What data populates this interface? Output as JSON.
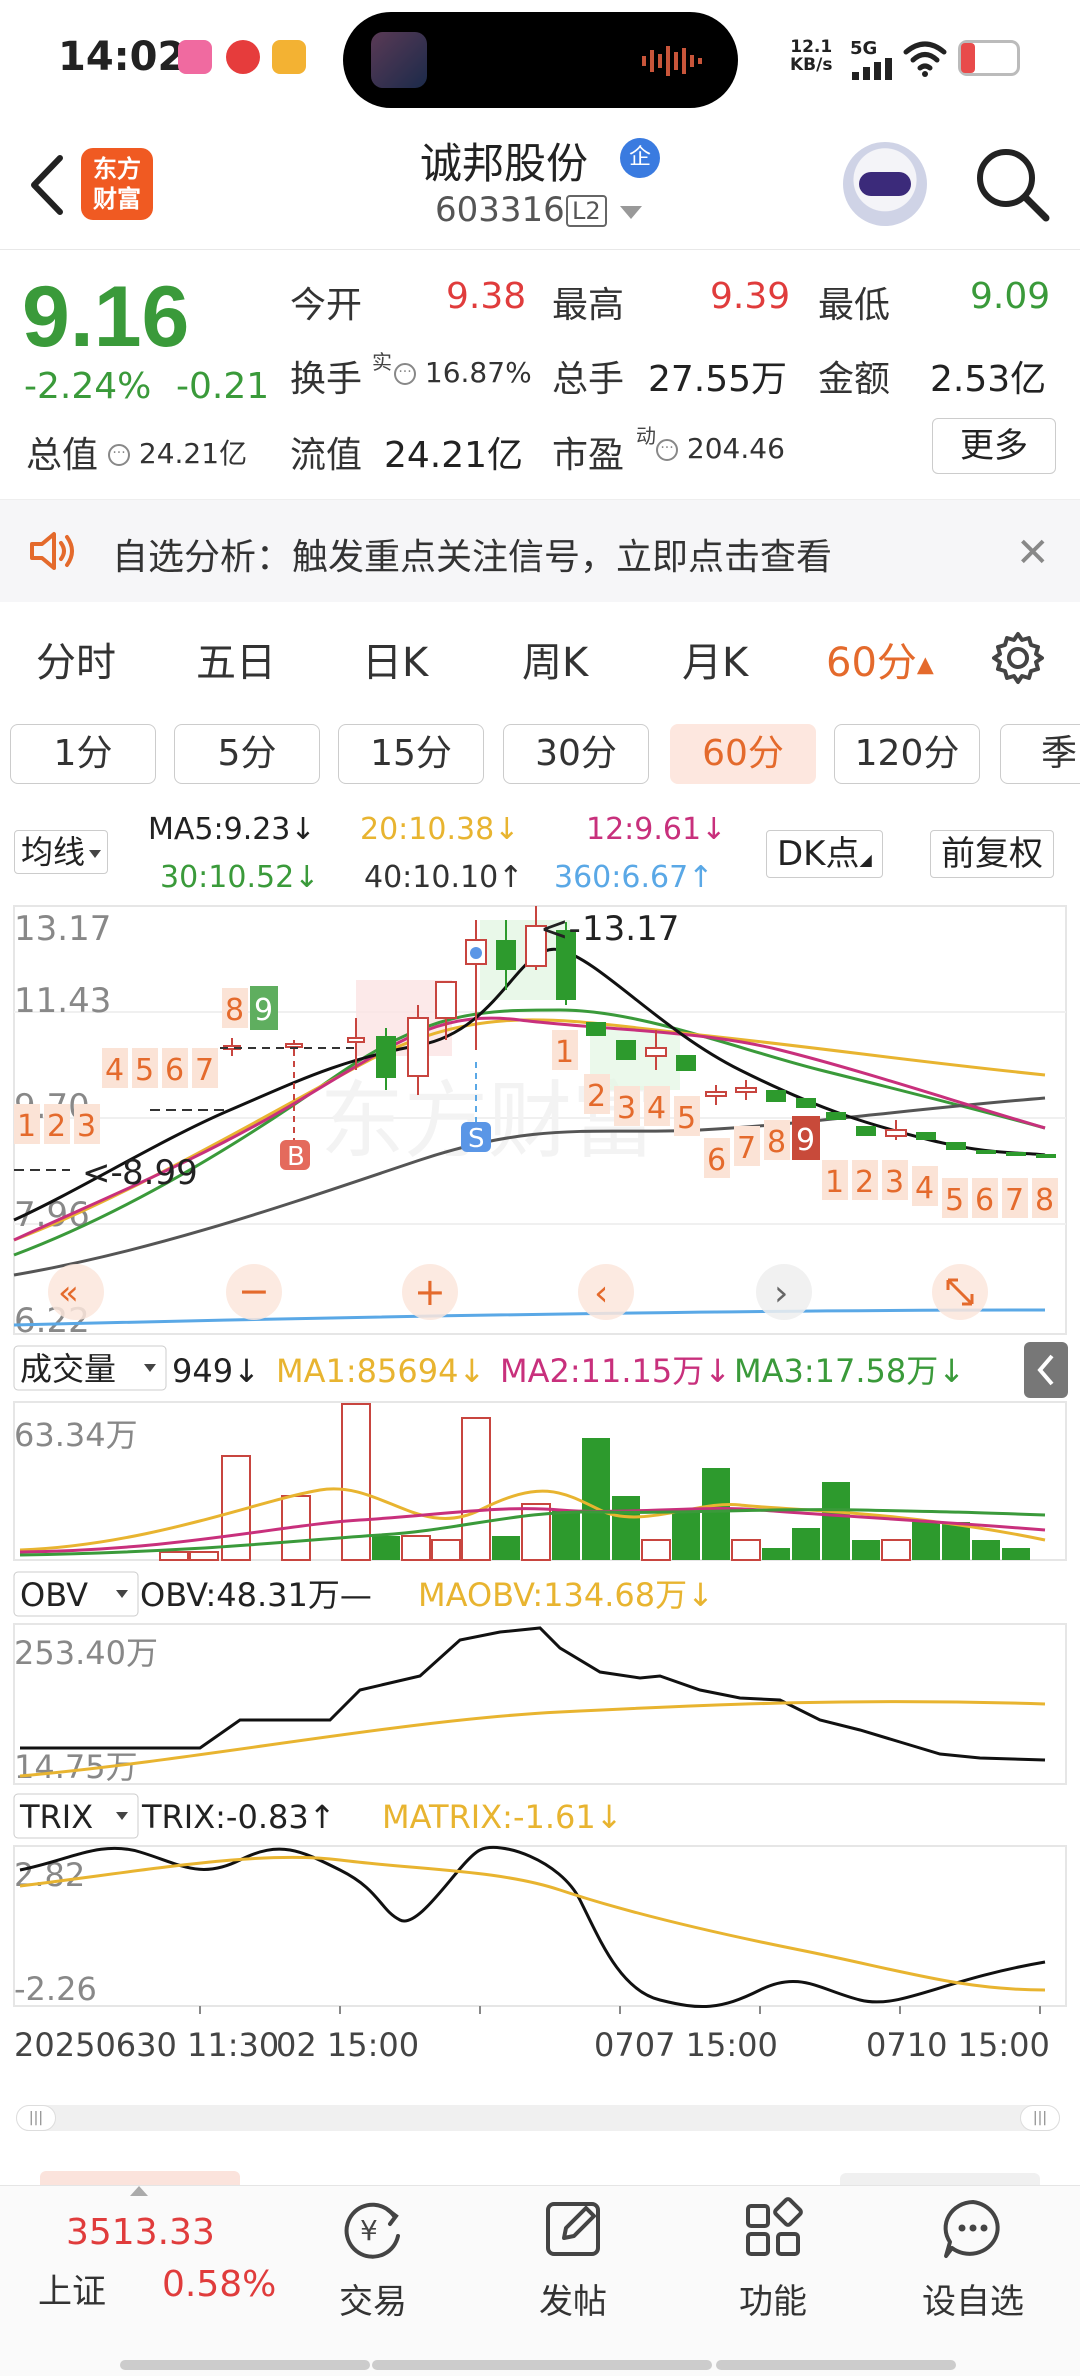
{
  "status": {
    "time": "14:02",
    "net_speed_value": "12.1",
    "net_speed_unit": "KB/s",
    "network": "5G",
    "battery_level": 0.15
  },
  "header": {
    "back_icon": "chevron-left-icon",
    "logo_line1": "东方",
    "logo_line2": "财富",
    "name": "诚邦股份",
    "badge": "企",
    "code": "603316",
    "level": "L2"
  },
  "quote": {
    "price": "9.16",
    "change_pct": "-2.24%",
    "change": "-0.21",
    "open_label": "今开",
    "open": "9.38",
    "high_label": "最高",
    "high": "9.39",
    "low_label": "最低",
    "low": "9.09",
    "turnover_label": "换手",
    "turnover_sup": "实",
    "turnover": "16.87%",
    "volume_label": "总手",
    "volume": "27.55万",
    "amount_label": "金额",
    "amount": "2.53亿",
    "mktcap_label": "总值",
    "mktcap": "24.21亿",
    "float_label": "流值",
    "float": "24.21亿",
    "pe_label": "市盈",
    "pe_sup": "动",
    "pe": "204.46",
    "more_label": "更多"
  },
  "alert": {
    "text": "自选分析：触发重点关注信号，立即点击查看"
  },
  "period_tabs": [
    {
      "label": "分时"
    },
    {
      "label": "五日"
    },
    {
      "label": "日K"
    },
    {
      "label": "周K"
    },
    {
      "label": "月K"
    },
    {
      "label": "60分"
    }
  ],
  "minute_tabs": [
    {
      "label": "1分"
    },
    {
      "label": "5分"
    },
    {
      "label": "15分"
    },
    {
      "label": "30分"
    },
    {
      "label": "60分"
    },
    {
      "label": "120分"
    },
    {
      "label": "季"
    }
  ],
  "indicators": {
    "main_select": "均线",
    "ma5": "MA5:9.23↓",
    "ma20": "20:10.38↓",
    "ma12": "12:9.61↓",
    "ma30": "30:10.52↓",
    "ma40": "40:10.10↑",
    "ma360": "360:6.67↑",
    "dk_button": "DK点",
    "adjust_button": "前复权"
  },
  "main_chart": {
    "y_labels": [
      "13.17",
      "11.43",
      "9.70",
      "7.96",
      "6.22"
    ],
    "high_mark": "13.17",
    "low_mark": "8.99",
    "buy_mark": "B",
    "sell_mark": "S",
    "counts_a": [
      "1",
      "2",
      "3",
      "4",
      "5",
      "6",
      "7",
      "8",
      "9"
    ],
    "counts_b": [
      "1",
      "2",
      "3",
      "4",
      "5",
      "6",
      "7",
      "8",
      "9"
    ],
    "counts_c": [
      "1",
      "2",
      "3",
      "4",
      "5",
      "6",
      "7",
      "8"
    ]
  },
  "volume_panel": {
    "select": "成交量",
    "vol": "949↓",
    "ma1": "MA1:85694↓",
    "ma2": "MA2:11.15万↓",
    "ma3": "MA3:17.58万↓",
    "y_max": "63.34万"
  },
  "obv_panel": {
    "select": "OBV",
    "obv": "OBV:48.31万—",
    "maobv": "MAOBV:134.68万↓",
    "y_max": "253.40万",
    "y_min": "14.75万"
  },
  "trix_panel": {
    "select": "TRIX",
    "trix": "TRIX:-0.83↑",
    "matrix": "MATRIX:-1.61↓",
    "y_max": "2.82",
    "y_min": "-2.26"
  },
  "x_labels": [
    "20250630 11:30",
    "02 15:00",
    "0707 15:00",
    "0710 15:00"
  ],
  "bottom": {
    "index_value": "3513.33",
    "index_name": "上证",
    "index_pct": "0.58%",
    "nav": [
      {
        "label": "交易",
        "icon": "yen-refresh-icon"
      },
      {
        "label": "发帖",
        "icon": "edit-icon"
      },
      {
        "label": "功能",
        "icon": "grid-icon"
      },
      {
        "label": "设自选",
        "icon": "chat-dots-icon"
      }
    ]
  },
  "colors": {
    "up": "#e03c3c",
    "down": "#3a9a3a",
    "accent": "#e46a2c"
  }
}
